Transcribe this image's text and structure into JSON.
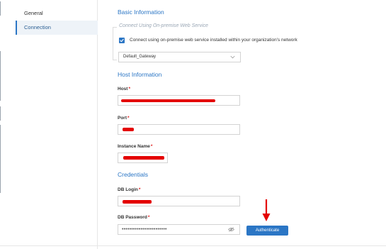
{
  "sidebar": {
    "items": [
      {
        "label": "General"
      },
      {
        "label": "Connection"
      }
    ]
  },
  "basic_info": {
    "title": "Basic Information",
    "onprem_title": "Connect Using On-premise Web Service",
    "checkbox_label": "Connect using on-premise web service installed within your organization's network",
    "checkbox_checked": true,
    "gateway_value": "Default_Gateway"
  },
  "host_info": {
    "title": "Host Information",
    "host_label": "Host",
    "port_label": "Port",
    "instance_label": "Instance Name"
  },
  "credentials": {
    "title": "Credentials",
    "login_label": "DB Login",
    "password_label": "DB Password",
    "password_mask": "••••••••••••••••••••••••",
    "authenticate_label": "Authenticate"
  },
  "required_marker": "*",
  "colors": {
    "accent": "#2b76c5",
    "redaction": "#e40000",
    "required": "#e01b1b"
  },
  "icons": {
    "checkbox": "check-icon",
    "dropdown": "chevron-down-icon",
    "password_toggle": "eye-slash-icon",
    "annotation": "red-arrow-down"
  }
}
